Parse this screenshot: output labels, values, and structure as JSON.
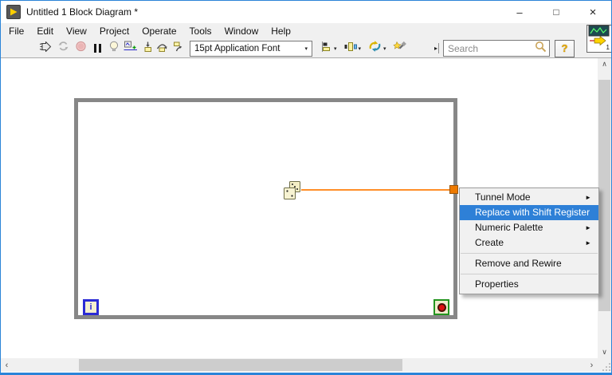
{
  "window": {
    "title": "Untitled 1 Block Diagram *",
    "controls": {
      "minimize": "–",
      "maximize": "□",
      "close": "×"
    }
  },
  "menubar": {
    "items": [
      "File",
      "Edit",
      "View",
      "Project",
      "Operate",
      "Tools",
      "Window",
      "Help"
    ]
  },
  "toolbar": {
    "font_selector": "15pt Application Font",
    "search_placeholder": "Search",
    "help_label": "?",
    "vi_number": "1"
  },
  "diagram": {
    "while_loop": {
      "iteration_terminal_label": "i"
    }
  },
  "context_menu": {
    "items": [
      {
        "label": "Tunnel Mode",
        "has_submenu": true
      },
      {
        "label": "Replace with Shift Register",
        "has_submenu": false,
        "highlighted": true
      },
      {
        "label": "Numeric Palette",
        "has_submenu": true
      },
      {
        "label": "Create",
        "has_submenu": true
      },
      {
        "label": "Remove and Rewire",
        "has_submenu": false
      },
      {
        "label": "Properties",
        "has_submenu": false
      }
    ]
  },
  "icons": {
    "dropdown_arrow": "▾",
    "overflow_chevron": "▸",
    "submenu_arrow": "►",
    "scroll_up": "∧",
    "scroll_down": "∨",
    "scroll_left": "‹",
    "scroll_right": "›"
  },
  "colors": {
    "window_border": "#2a84d8",
    "menu_highlight": "#2e80d7",
    "wire_orange": "#ff8f2a",
    "tunnel_orange": "#ee7a00",
    "loop_border_gray": "#878787",
    "iteration_terminal_blue": "#2b2bd5",
    "condition_terminal_green": "#23951f",
    "stop_red": "#dd1111"
  }
}
